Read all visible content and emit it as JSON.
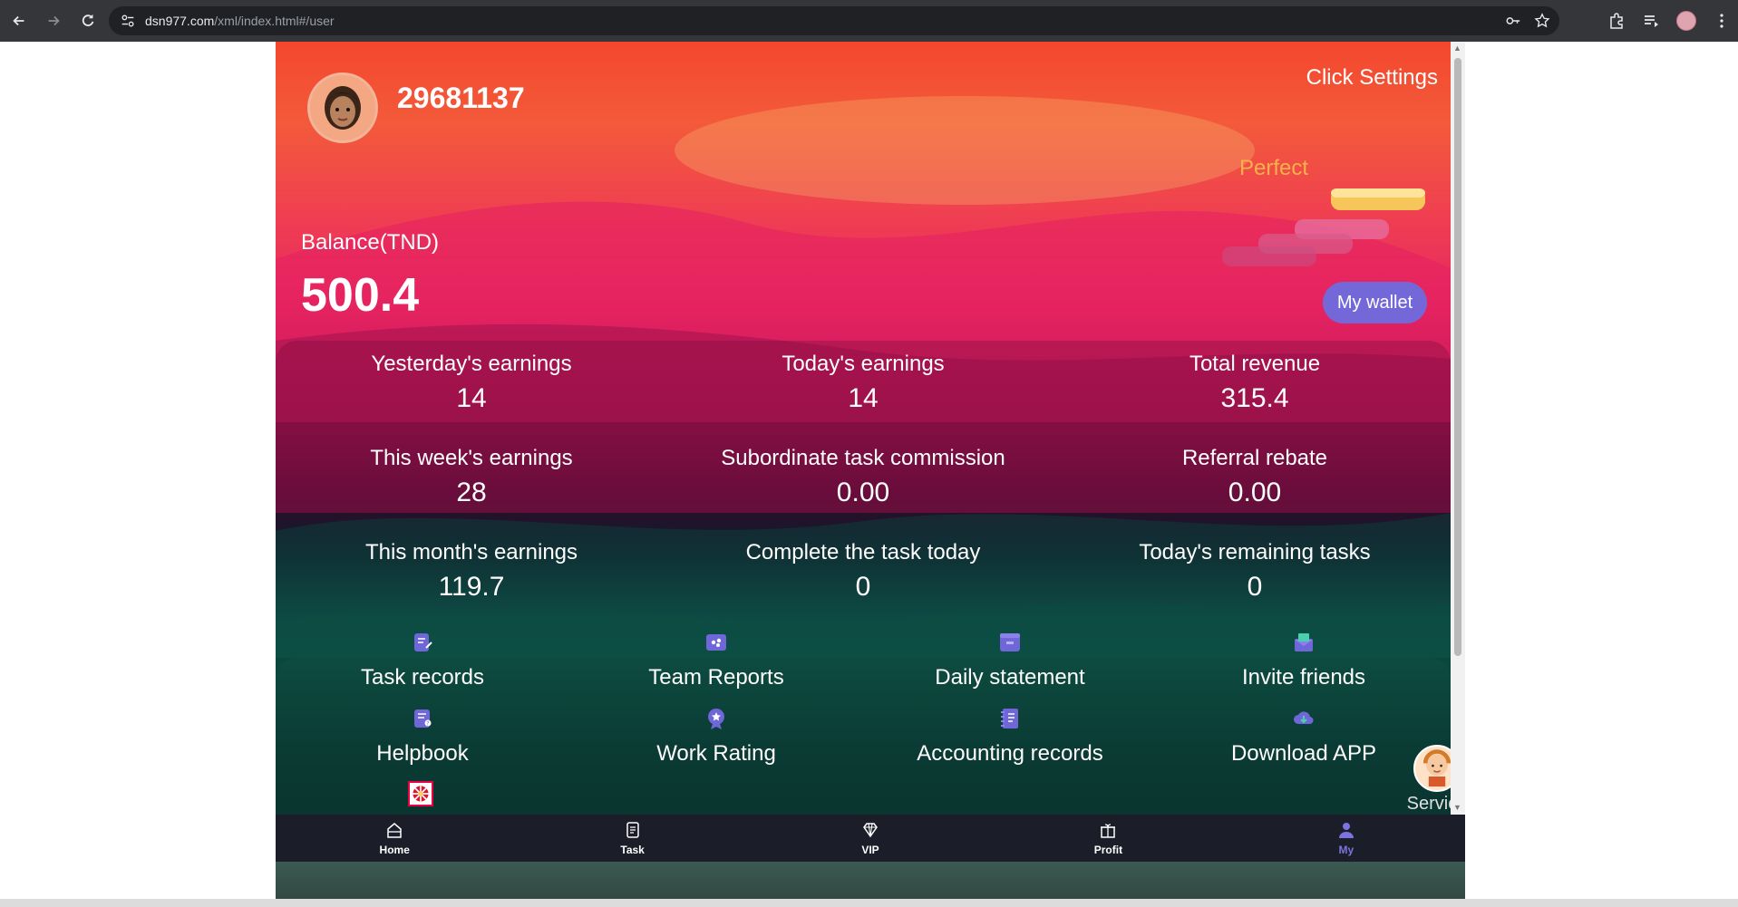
{
  "browser": {
    "url_host": "dsn977.com",
    "url_path": "/xml/index.html#/user"
  },
  "profile": {
    "user_id": "29681137",
    "settings_link": "Click Settings",
    "level_name": "Perfect"
  },
  "balance": {
    "label": "Balance(TND)",
    "value": "500.4",
    "wallet_button": "My wallet"
  },
  "stats": [
    {
      "label": "Yesterday's earnings",
      "value": "14"
    },
    {
      "label": "Today's earnings",
      "value": "14"
    },
    {
      "label": "Total revenue",
      "value": "315.4"
    },
    {
      "label": "This week's earnings",
      "value": "28"
    },
    {
      "label": "Subordinate task commission",
      "value": "0.00"
    },
    {
      "label": "Referral rebate",
      "value": "0.00"
    },
    {
      "label": "This month's earnings",
      "value": "119.7"
    },
    {
      "label": "Complete the task today",
      "value": "0"
    },
    {
      "label": "Today's remaining tasks",
      "value": "0"
    }
  ],
  "menu": [
    {
      "label": "Task records",
      "icon": "task-records-icon"
    },
    {
      "label": "Team Reports",
      "icon": "team-reports-icon"
    },
    {
      "label": "Daily statement",
      "icon": "daily-statement-icon"
    },
    {
      "label": "Invite friends",
      "icon": "invite-friends-icon"
    },
    {
      "label": "Helpbook",
      "icon": "helpbook-icon"
    },
    {
      "label": "Work Rating",
      "icon": "work-rating-icon"
    },
    {
      "label": "Accounting records",
      "icon": "accounting-records-icon"
    },
    {
      "label": "Download APP",
      "icon": "download-app-icon"
    }
  ],
  "service": {
    "label": "Service"
  },
  "tabbar": [
    {
      "label": "Home",
      "icon": "home-icon",
      "active": false
    },
    {
      "label": "Task",
      "icon": "task-icon",
      "active": false
    },
    {
      "label": "VIP",
      "icon": "diamond-icon",
      "active": false
    },
    {
      "label": "Profit",
      "icon": "gift-icon",
      "active": false
    },
    {
      "label": "My",
      "icon": "user-icon",
      "active": true
    }
  ],
  "colors": {
    "accent": "#7468d8",
    "level_text": "#f6b24a",
    "tabbar_bg": "#1b1d29"
  }
}
